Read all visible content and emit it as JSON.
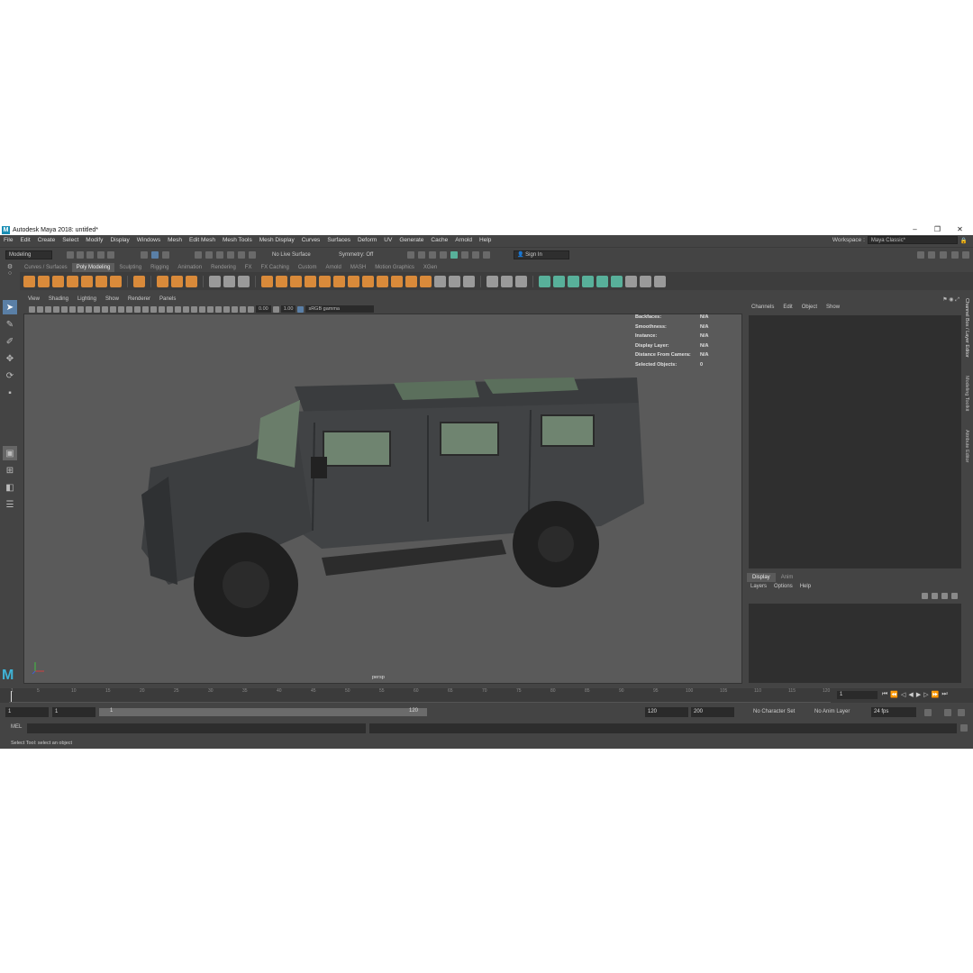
{
  "window": {
    "title": "Autodesk Maya 2018: untitled*",
    "minimize": "–",
    "maximize": "❐",
    "close": "✕"
  },
  "menus": [
    "File",
    "Edit",
    "Create",
    "Select",
    "Modify",
    "Display",
    "Windows",
    "Mesh",
    "Edit Mesh",
    "Mesh Tools",
    "Mesh Display",
    "Curves",
    "Surfaces",
    "Deform",
    "UV",
    "Generate",
    "Cache",
    "Arnold",
    "Help"
  ],
  "workspace": {
    "label": "Workspace :",
    "value": "Maya Classic*"
  },
  "statusline": {
    "mode": "Modeling",
    "live_surface": "No Live Surface",
    "symmetry": "Symmetry: Off",
    "sign_in": "Sign In"
  },
  "shelf_tabs": [
    "Curves / Surfaces",
    "Poly Modeling",
    "Sculpting",
    "Rigging",
    "Animation",
    "Rendering",
    "FX",
    "FX Caching",
    "Custom",
    "Arnold",
    "MASH",
    "Motion Graphics",
    "XGen"
  ],
  "active_shelf_tab": "Poly Modeling",
  "viewport": {
    "menus": [
      "View",
      "Shading",
      "Lighting",
      "Show",
      "Renderer",
      "Panels"
    ],
    "field1": "0.00",
    "field2": "1.00",
    "color_space": "sRGB gamma",
    "camera": "persp",
    "hud": [
      {
        "k": "Backfaces:",
        "v": "N/A"
      },
      {
        "k": "Smoothness:",
        "v": "N/A"
      },
      {
        "k": "Instance:",
        "v": "N/A"
      },
      {
        "k": "Display Layer:",
        "v": "N/A"
      },
      {
        "k": "Distance From Camera:",
        "v": "N/A"
      },
      {
        "k": "Selected Objects:",
        "v": "0"
      }
    ]
  },
  "channel_box": {
    "menus": [
      "Channels",
      "Edit",
      "Object",
      "Show"
    ]
  },
  "layer_editor": {
    "tabs": [
      "Display",
      "Anim"
    ],
    "menus": [
      "Layers",
      "Options",
      "Help"
    ]
  },
  "side_tabs": [
    "Channel Box / Layer Editor",
    "Modeling Toolkit",
    "Attribute Editor"
  ],
  "timeline": {
    "ticks": [
      "1",
      "5",
      "10",
      "15",
      "20",
      "25",
      "30",
      "35",
      "40",
      "45",
      "50",
      "55",
      "60",
      "65",
      "70",
      "75",
      "80",
      "85",
      "90",
      "95",
      "100",
      "105",
      "110",
      "115",
      "120"
    ],
    "current_frame": "1"
  },
  "range": {
    "start": "1",
    "playback_start": "1",
    "slider_start": "1",
    "slider_end": "120",
    "playback_end": "120",
    "end": "200",
    "character_set": "No Character Set",
    "anim_layer": "No Anim Layer",
    "fps": "24 fps"
  },
  "command_line": {
    "lang": "MEL"
  },
  "help_line": "Select Tool: select an object"
}
